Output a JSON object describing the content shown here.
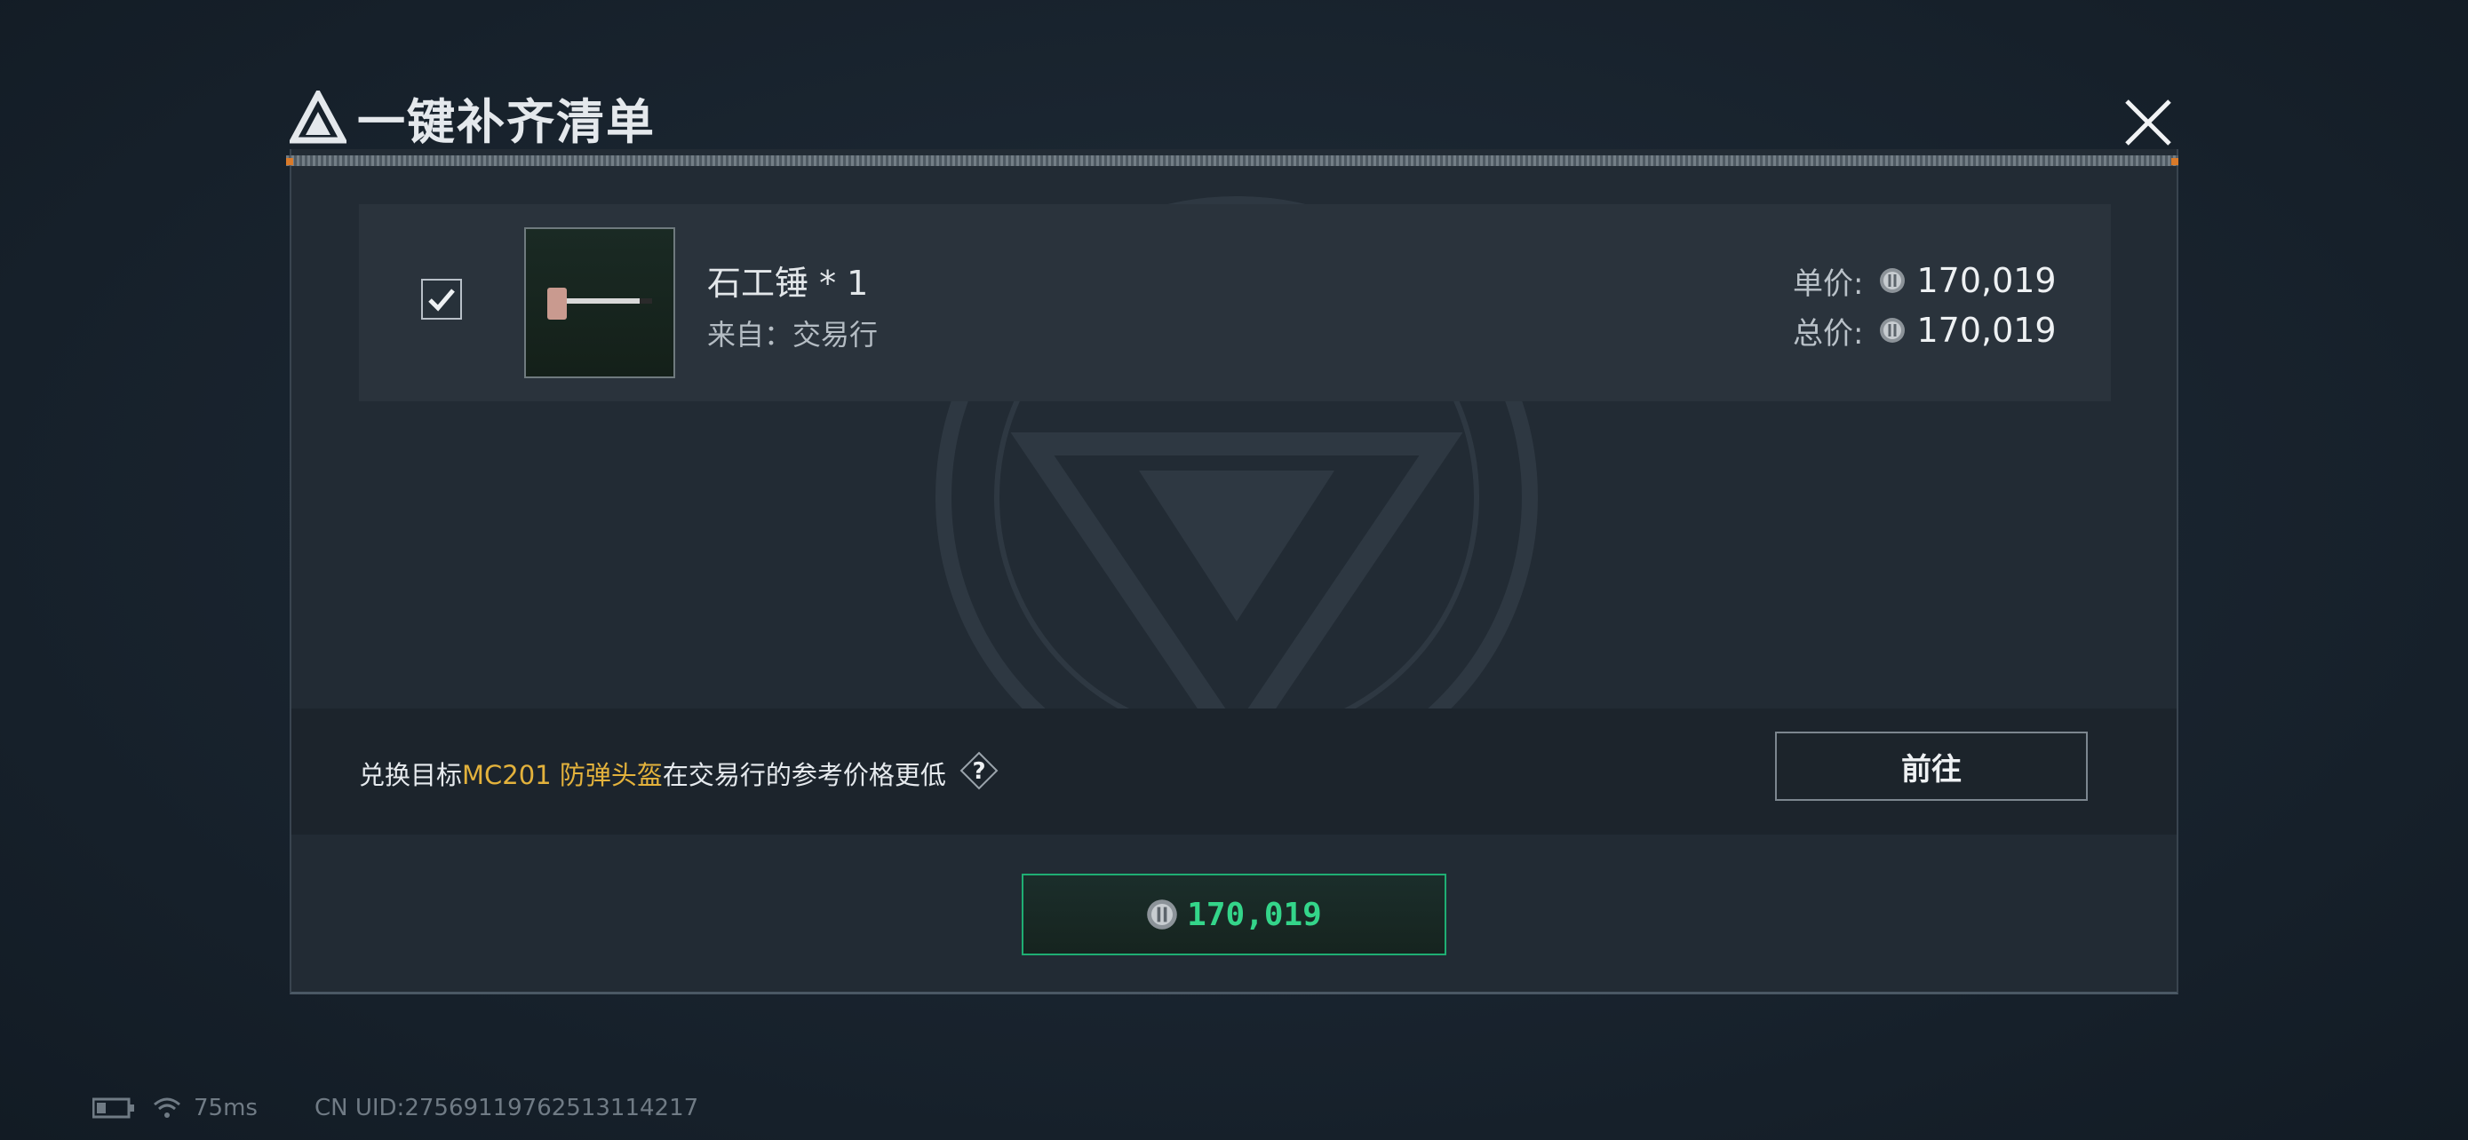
{
  "dialog": {
    "title": "一键补齐清单"
  },
  "item": {
    "name": "石工锤 * 1",
    "source": "来自：交易行",
    "checked": true,
    "unit_price_label": "单价:",
    "unit_price": "170,019",
    "total_price_label": "总价:",
    "total_price": "170,019"
  },
  "notice": {
    "prefix": "兑换目标",
    "highlight": "MC201 防弹头盔",
    "suffix": "在交易行的参考价格更低",
    "help_symbol": "?",
    "goto_label": "前往"
  },
  "pay": {
    "amount": "170,019"
  },
  "status": {
    "ping": "75ms",
    "uid": "CN UID:27569119762513114217"
  },
  "colors": {
    "accent_green": "#34d58a",
    "highlight_yellow": "#e3b23c",
    "panel_bg": "#222b34"
  },
  "icons": [
    "game-logo-icon",
    "close-icon",
    "check-icon",
    "hammer-icon",
    "coin-icon",
    "help-icon",
    "battery-icon",
    "wifi-icon"
  ]
}
